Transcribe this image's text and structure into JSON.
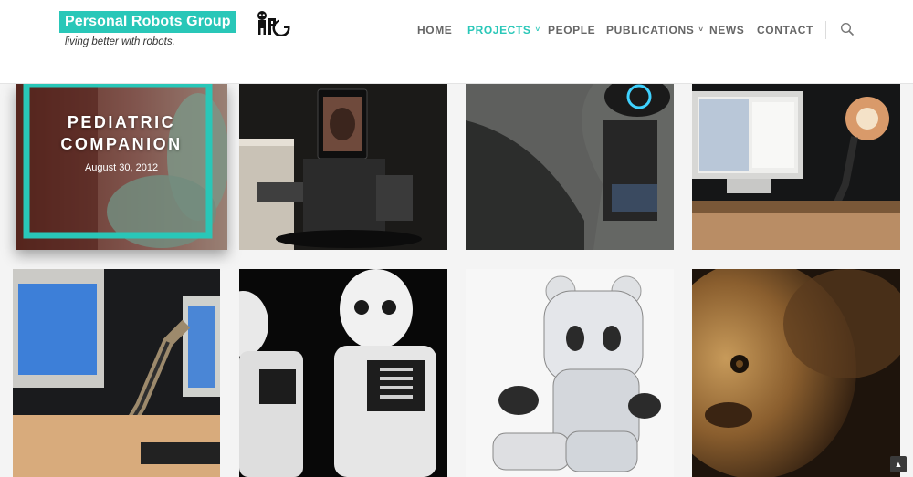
{
  "brand": {
    "title": "Personal Robots Group",
    "tagline": "living better with robots.",
    "mark_text": "PRG",
    "accent_color": "#29c7b8"
  },
  "nav": {
    "items": [
      {
        "label": "HOME",
        "active": false,
        "has_dropdown": false
      },
      {
        "label": "PROJECTS",
        "active": true,
        "has_dropdown": true
      },
      {
        "label": "PEOPLE",
        "active": false,
        "has_dropdown": false
      },
      {
        "label": "PUBLICATIONS",
        "active": false,
        "has_dropdown": true
      },
      {
        "label": "NEWS",
        "active": false,
        "has_dropdown": false
      },
      {
        "label": "CONTACT",
        "active": false,
        "has_dropdown": false
      }
    ],
    "search_icon": "search-icon",
    "dropdown_glyph": "˅"
  },
  "projects": {
    "featured": {
      "title_line1": "PEDIATRIC",
      "title_line2": "COMPANION",
      "date": "August 30, 2012"
    }
  },
  "scroll_top_glyph": "▲"
}
